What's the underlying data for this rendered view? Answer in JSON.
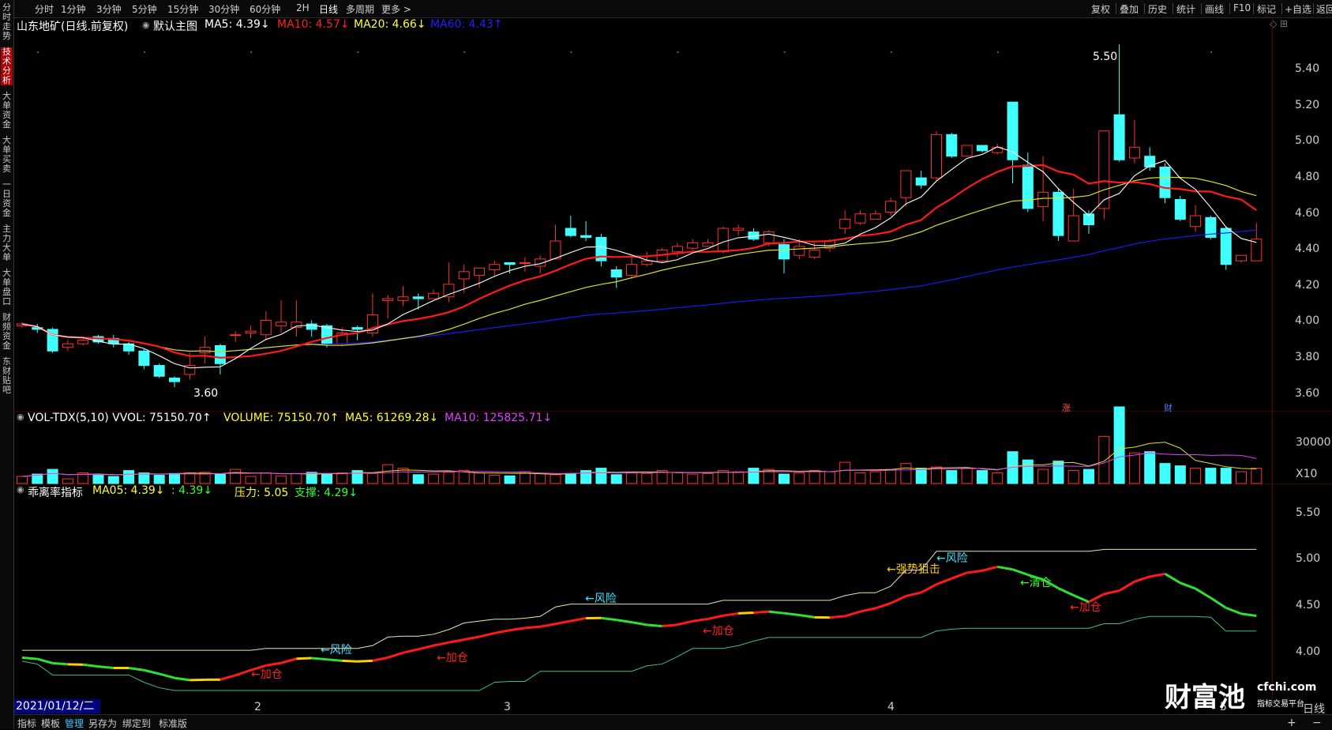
{
  "sidebar": {
    "tabs": [
      {
        "label": "分时走势",
        "active": false
      },
      {
        "label": "技术分析",
        "active": true
      },
      {
        "label": "大单资金",
        "active": false
      },
      {
        "label": "大单买卖",
        "active": false
      },
      {
        "label": "一日资金",
        "active": false
      },
      {
        "label": "主力大单",
        "active": false
      },
      {
        "label": "大单盘口",
        "active": false
      },
      {
        "label": "财频资金",
        "active": false
      },
      {
        "label": "东财贴吧",
        "active": false
      }
    ]
  },
  "periods": [
    "分时",
    "1分钟",
    "3分钟",
    "5分钟",
    "15分钟",
    "30分钟",
    "60分钟",
    "2H",
    "日线",
    "多周期",
    "更多 >"
  ],
  "active_period": "日线",
  "tools": [
    "复权",
    "叠加",
    "历史",
    "统计",
    "画线",
    "F10",
    "标记",
    "+自选",
    "返回"
  ],
  "main": {
    "title": "山东地矿(日线.前复权)",
    "template": "默认主图",
    "ma5": "MA5: 4.39↓",
    "ma10": "MA10: 4.57↓",
    "ma20": "MA20: 4.66↓",
    "ma60": "MA60: 4.43↑",
    "high_label": "5.50",
    "low_label": "3.60",
    "price_labels": [
      "5.40",
      "5.20",
      "5.00",
      "4.80",
      "4.60",
      "4.40",
      "4.20",
      "4.00",
      "3.80",
      "3.60"
    ],
    "markers": {
      "rise": "涨",
      "fin": "财"
    }
  },
  "volume": {
    "title": "VOL-TDX(5,10) VVOL: 75150.70↑",
    "vol": "VOLUME: 75150.70↑",
    "ma5": "MA5: 61269.28↓",
    "ma10": "MA10: 125825.71↓",
    "axis_top": "30000",
    "axis_unit": "X10"
  },
  "indicator": {
    "title": "乖离率指标",
    "ma05": "MA05: 4.39↓",
    "val": ": 4.39↓",
    "pressure": "压力: 5.05",
    "support": "支撑: 4.29↓",
    "labels": [
      "5.50",
      "5.00",
      "4.50",
      "4.00"
    ],
    "signals": [
      {
        "text": "←加仓",
        "color": "#ff2020"
      },
      {
        "text": "←风险",
        "color": "#40e0ff"
      },
      {
        "text": "←加仓",
        "color": "#ff2020"
      },
      {
        "text": "←风险",
        "color": "#40e0ff"
      },
      {
        "text": "←加仓",
        "color": "#ff2020"
      },
      {
        "text": "←强势狙击",
        "color": "#ffd000"
      },
      {
        "text": "←风险",
        "color": "#40e0ff"
      },
      {
        "text": "←清仓",
        "color": "#30ff30"
      },
      {
        "text": "←加仓",
        "color": "#ff2020"
      }
    ]
  },
  "xaxis": {
    "date": "2021/01/12/二",
    "months": [
      "2",
      "3",
      "4",
      "5"
    ],
    "right": "日线"
  },
  "bottom_tabs": [
    "指标",
    "模板",
    "管理",
    "另存为",
    "绑定到",
    "标准版"
  ],
  "active_bottom": "管理",
  "brand": {
    "cn": "财富池",
    "url": "cfchi.com",
    "sub": "指标交易平台"
  },
  "colors": {
    "up": "#ff3030",
    "down": "#40ffff",
    "ma5": "#ffffff",
    "ma10": "#ff1a1a",
    "ma20": "#e0e020",
    "ma60": "#1818ff"
  },
  "candles": [
    [
      3.94,
      3.95,
      3.93,
      3.96
    ],
    [
      3.93,
      3.92,
      3.9,
      3.95
    ],
    [
      3.92,
      3.8,
      3.79,
      3.93
    ],
    [
      3.82,
      3.84,
      3.8,
      3.86
    ],
    [
      3.84,
      3.86,
      3.83,
      3.88
    ],
    [
      3.88,
      3.85,
      3.84,
      3.89
    ],
    [
      3.87,
      3.84,
      3.82,
      3.89
    ],
    [
      3.84,
      3.8,
      3.78,
      3.85
    ],
    [
      3.8,
      3.72,
      3.7,
      3.81
    ],
    [
      3.72,
      3.66,
      3.65,
      3.73
    ],
    [
      3.65,
      3.63,
      3.6,
      3.66
    ],
    [
      3.67,
      3.72,
      3.64,
      3.79
    ],
    [
      3.79,
      3.82,
      3.73,
      3.88
    ],
    [
      3.83,
      3.73,
      3.67,
      3.84
    ],
    [
      3.89,
      3.89,
      3.85,
      3.91
    ],
    [
      3.9,
      3.91,
      3.87,
      3.94
    ],
    [
      3.89,
      3.97,
      3.86,
      4.02
    ],
    [
      3.94,
      3.96,
      3.9,
      4.08
    ],
    [
      3.93,
      3.96,
      3.88,
      4.08
    ],
    [
      3.95,
      3.92,
      3.88,
      3.97
    ],
    [
      3.94,
      3.84,
      3.82,
      3.95
    ],
    [
      3.84,
      3.9,
      3.83,
      3.93
    ],
    [
      3.93,
      3.92,
      3.86,
      3.94
    ],
    [
      3.9,
      4.0,
      3.88,
      4.12
    ],
    [
      4.08,
      4.09,
      3.98,
      4.11
    ],
    [
      4.08,
      4.1,
      4.05,
      4.16
    ],
    [
      4.1,
      4.09,
      4.03,
      4.12
    ],
    [
      4.09,
      4.12,
      4.09,
      4.14
    ],
    [
      4.1,
      4.17,
      4.07,
      4.29
    ],
    [
      4.2,
      4.24,
      4.12,
      4.28
    ],
    [
      4.22,
      4.26,
      4.15,
      4.26
    ],
    [
      4.25,
      4.28,
      4.21,
      4.3
    ],
    [
      4.29,
      4.28,
      4.23,
      4.29
    ],
    [
      4.29,
      4.29,
      4.24,
      4.32
    ],
    [
      4.27,
      4.31,
      4.23,
      4.33
    ],
    [
      4.31,
      4.41,
      4.31,
      4.5
    ],
    [
      4.48,
      4.44,
      4.43,
      4.55
    ],
    [
      4.44,
      4.43,
      4.41,
      4.52
    ],
    [
      4.43,
      4.3,
      4.27,
      4.45
    ],
    [
      4.25,
      4.21,
      4.15,
      4.27
    ],
    [
      4.22,
      4.28,
      4.2,
      4.32
    ],
    [
      4.28,
      4.3,
      4.27,
      4.35
    ],
    [
      4.3,
      4.36,
      4.29,
      4.37
    ],
    [
      4.35,
      4.38,
      4.32,
      4.4
    ],
    [
      4.37,
      4.4,
      4.36,
      4.42
    ],
    [
      4.38,
      4.4,
      4.38,
      4.42
    ],
    [
      4.35,
      4.48,
      4.34,
      4.49
    ],
    [
      4.47,
      4.48,
      4.44,
      4.5
    ],
    [
      4.46,
      4.42,
      4.41,
      4.48
    ],
    [
      4.4,
      4.46,
      4.38,
      4.47
    ],
    [
      4.39,
      4.31,
      4.23,
      4.42
    ],
    [
      4.33,
      4.38,
      4.31,
      4.42
    ],
    [
      4.32,
      4.36,
      4.31,
      4.4
    ],
    [
      4.37,
      4.41,
      4.35,
      4.42
    ],
    [
      4.48,
      4.53,
      4.45,
      4.58
    ],
    [
      4.51,
      4.56,
      4.5,
      4.58
    ],
    [
      4.53,
      4.56,
      4.53,
      4.58
    ],
    [
      4.57,
      4.63,
      4.55,
      4.65
    ],
    [
      4.65,
      4.8,
      4.6,
      4.8
    ],
    [
      4.76,
      4.72,
      4.7,
      4.8
    ],
    [
      4.76,
      5.0,
      4.74,
      5.02
    ],
    [
      5.0,
      4.88,
      4.87,
      5.01
    ],
    [
      4.88,
      4.94,
      4.88,
      4.94
    ],
    [
      4.94,
      4.91,
      4.9,
      4.92
    ],
    [
      4.9,
      4.93,
      4.89,
      4.95
    ],
    [
      5.18,
      4.86,
      4.73,
      5.18
    ],
    [
      4.83,
      4.59,
      4.57,
      4.9
    ],
    [
      4.6,
      4.68,
      4.52,
      4.88
    ],
    [
      4.68,
      4.44,
      4.41,
      4.7
    ],
    [
      4.41,
      4.55,
      4.41,
      4.7
    ],
    [
      4.56,
      4.5,
      4.45,
      4.58
    ],
    [
      4.59,
      5.02,
      4.53,
      5.02
    ],
    [
      5.11,
      4.86,
      4.85,
      5.5
    ],
    [
      4.87,
      4.93,
      4.84,
      5.08
    ],
    [
      4.88,
      4.82,
      4.8,
      4.93
    ],
    [
      4.82,
      4.65,
      4.62,
      4.84
    ],
    [
      4.64,
      4.53,
      4.52,
      4.66
    ],
    [
      4.49,
      4.55,
      4.46,
      4.61
    ],
    [
      4.54,
      4.43,
      4.42,
      4.55
    ],
    [
      4.48,
      4.28,
      4.25,
      4.49
    ],
    [
      4.3,
      4.33,
      4.29,
      4.33
    ],
    [
      4.3,
      4.42,
      4.3,
      4.51
    ]
  ],
  "volumes": [
    60,
    80,
    120,
    40,
    90,
    70,
    60,
    110,
    90,
    70,
    85,
    90,
    95,
    80,
    120,
    60,
    90,
    65,
    85,
    95,
    80,
    90,
    110,
    85,
    160,
    130,
    75,
    80,
    95,
    110,
    90,
    70,
    65,
    100,
    85,
    75,
    85,
    110,
    130,
    75,
    90,
    85,
    110,
    95,
    80,
    85,
    110,
    100,
    130,
    120,
    80,
    90,
    110,
    100,
    180,
    90,
    100,
    120,
    170,
    130,
    140,
    110,
    130,
    110,
    90,
    270,
    200,
    120,
    190,
    110,
    120,
    400,
    650,
    260,
    270,
    170,
    150,
    130,
    130,
    130,
    100,
    130
  ]
}
